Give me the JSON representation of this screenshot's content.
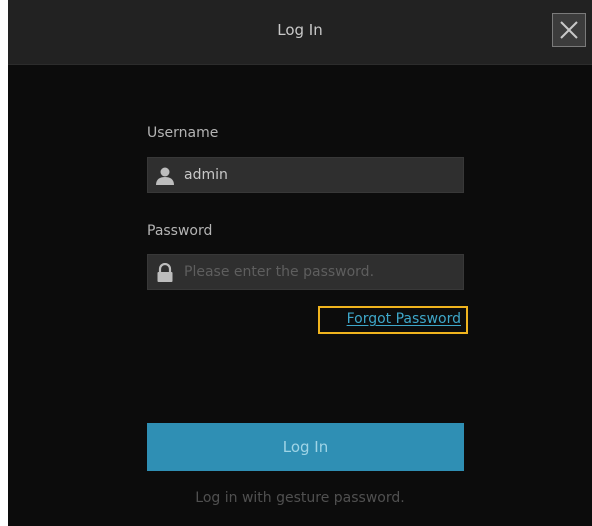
{
  "dialog": {
    "title": "Log In",
    "close_icon": "close-icon"
  },
  "username": {
    "label": "Username",
    "value": "admin",
    "icon": "user-icon"
  },
  "password": {
    "label": "Password",
    "placeholder": "Please enter the password.",
    "icon": "lock-icon"
  },
  "forgot_password": {
    "label": "Forgot Password",
    "highlight_color": "#f0b41e"
  },
  "login_button": {
    "label": "Log In",
    "color": "#2f8fb4"
  },
  "gesture_login": {
    "label": "Log in with gesture password."
  }
}
